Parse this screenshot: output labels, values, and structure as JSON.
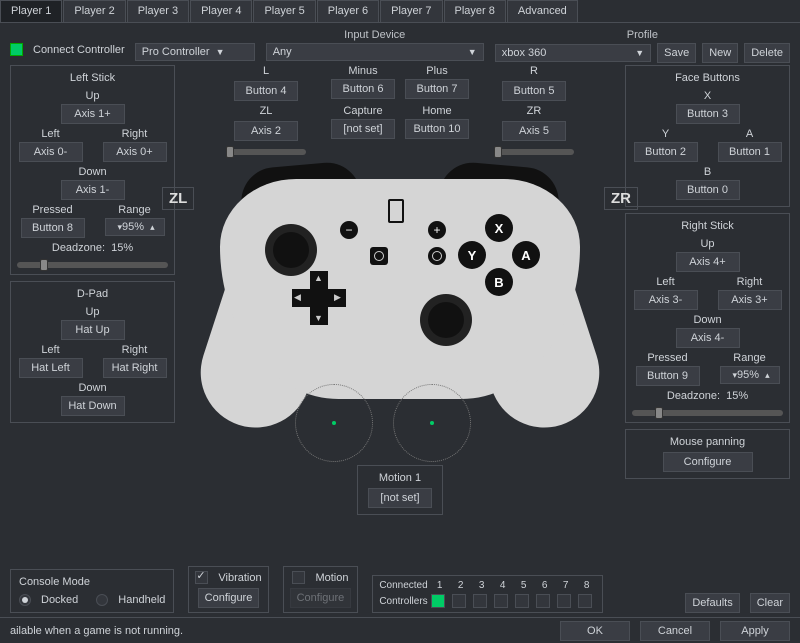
{
  "tabs": [
    "Player 1",
    "Player 2",
    "Player 3",
    "Player 4",
    "Player 5",
    "Player 6",
    "Player 7",
    "Player 8",
    "Advanced"
  ],
  "active_tab": 0,
  "connect_label": "Connect Controller",
  "input_device_label": "Input Device",
  "profile_label": "Profile",
  "controller_type": "Pro Controller",
  "input_device": "Any",
  "profile": "xbox 360",
  "profile_actions": {
    "save": "Save",
    "new": "New",
    "delete": "Delete"
  },
  "left_stick": {
    "title": "Left Stick",
    "up": {
      "label": "Up",
      "bind": "Axis 1+"
    },
    "down": {
      "label": "Down",
      "bind": "Axis 1-"
    },
    "left": {
      "label": "Left",
      "bind": "Axis 0-"
    },
    "right": {
      "label": "Right",
      "bind": "Axis 0+"
    },
    "pressed": {
      "label": "Pressed",
      "bind": "Button 8"
    },
    "range": {
      "label": "Range",
      "value": "95%"
    },
    "deadzone": {
      "label": "Deadzone:",
      "value": "15%",
      "pos": 15
    }
  },
  "dpad": {
    "title": "D-Pad",
    "up": {
      "label": "Up",
      "bind": "Hat Up"
    },
    "down": {
      "label": "Down",
      "bind": "Hat Down"
    },
    "left": {
      "label": "Left",
      "bind": "Hat Left"
    },
    "right": {
      "label": "Right",
      "bind": "Hat Right"
    }
  },
  "lz": {
    "L": {
      "label": "L",
      "bind": "Button 4"
    },
    "ZL": {
      "label": "ZL",
      "bind": "Axis 2"
    }
  },
  "rz": {
    "R": {
      "label": "R",
      "bind": "Button 5"
    },
    "ZR": {
      "label": "ZR",
      "bind": "Axis 5"
    }
  },
  "center_buttons": {
    "minus": {
      "label": "Minus",
      "bind": "Button 6"
    },
    "plus": {
      "label": "Plus",
      "bind": "Button 7"
    },
    "capture": {
      "label": "Capture",
      "bind": "[not set]"
    },
    "home": {
      "label": "Home",
      "bind": "Button 10"
    }
  },
  "face": {
    "title": "Face Buttons",
    "X": {
      "label": "X",
      "bind": "Button 3"
    },
    "Y": {
      "label": "Y",
      "bind": "Button 2"
    },
    "A": {
      "label": "A",
      "bind": "Button 1"
    },
    "B": {
      "label": "B",
      "bind": "Button 0"
    }
  },
  "right_stick": {
    "title": "Right Stick",
    "up": {
      "label": "Up",
      "bind": "Axis 4+"
    },
    "down": {
      "label": "Down",
      "bind": "Axis 4-"
    },
    "left": {
      "label": "Left",
      "bind": "Axis 3-"
    },
    "right": {
      "label": "Right",
      "bind": "Axis 3+"
    },
    "pressed": {
      "label": "Pressed",
      "bind": "Button 9"
    },
    "range": {
      "label": "Range",
      "value": "95%"
    },
    "deadzone": {
      "label": "Deadzone:",
      "value": "15%",
      "pos": 15
    }
  },
  "mouse_panning": {
    "title": "Mouse panning",
    "button": "Configure"
  },
  "motion1": {
    "title": "Motion 1",
    "bind": "[not set]"
  },
  "zl_label": "ZL",
  "zr_label": "ZR",
  "console_mode": {
    "title": "Console Mode",
    "docked": "Docked",
    "handheld": "Handheld",
    "value": "docked"
  },
  "vibration": {
    "label": "Vibration",
    "checked": true,
    "configure": "Configure"
  },
  "motion": {
    "label": "Motion",
    "checked": false,
    "configure": "Configure"
  },
  "connected": {
    "label": "Connected",
    "controllers": "Controllers",
    "slots": [
      true,
      false,
      false,
      false,
      false,
      false,
      false,
      false
    ]
  },
  "defaults_btn": "Defaults",
  "clear_btn": "Clear",
  "footer": {
    "msg": "ailable when a game is not running.",
    "ok": "OK",
    "cancel": "Cancel",
    "apply": "Apply"
  }
}
